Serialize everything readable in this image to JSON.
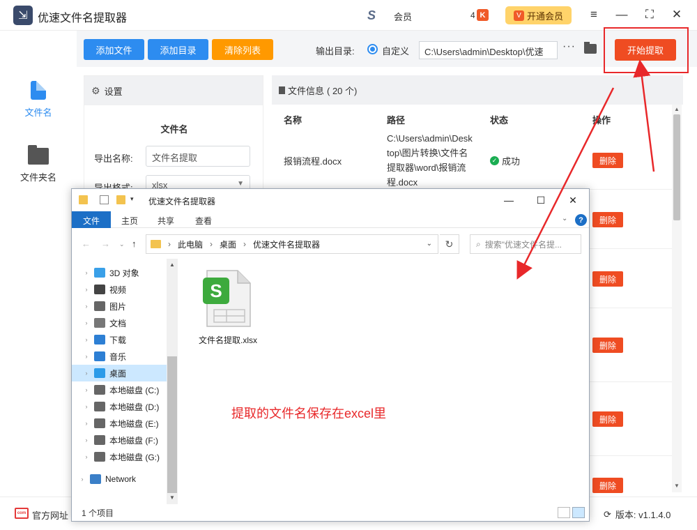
{
  "app": {
    "title": "优速文件名提取器",
    "vip_label": "会员",
    "coupon_count": "4",
    "open_vip_label": "开通会员"
  },
  "sidebar": {
    "items": [
      {
        "label": "文件名"
      },
      {
        "label": "文件夹名"
      }
    ]
  },
  "toolbar": {
    "add_file": "添加文件",
    "add_dir": "添加目录",
    "clear_list": "清除列表",
    "output_label": "输出目录:",
    "custom_label": "自定义",
    "output_path": "C:\\Users\\admin\\Desktop\\优速",
    "more": "···",
    "start": "开始提取"
  },
  "settings": {
    "header": "设置",
    "section": "文件名",
    "export_name_label": "导出名称:",
    "export_name_value": "文件名提取",
    "export_format_label": "导出格式:",
    "export_format_value": "xlsx"
  },
  "file_info": {
    "header": "文件信息",
    "count": "( 20 个)",
    "columns": [
      "名称",
      "路径",
      "状态",
      "操作"
    ],
    "rows": [
      {
        "name": "报销流程.docx",
        "path": "C:\\Users\\admin\\Desktop\\图片转换\\文件名提取器\\word\\报销流程.docx",
        "status": "成功",
        "action": "删除"
      },
      {
        "action": "删除"
      },
      {
        "action": "删除"
      },
      {
        "action": "删除"
      },
      {
        "action": "删除"
      },
      {
        "action": "删除"
      }
    ]
  },
  "statusbar": {
    "site_icon_text": "com",
    "site_link": "官方网址",
    "version": "版本: v1.1.4.0"
  },
  "explorer": {
    "title": "优速文件名提取器",
    "ribbon_tabs": [
      "文件",
      "主页",
      "共享",
      "查看"
    ],
    "breadcrumb": [
      "此电脑",
      "桌面",
      "优速文件名提取器"
    ],
    "search_placeholder": "搜索\"优速文件名提...",
    "tree": [
      {
        "label": "3D 对象",
        "icon": "cube-icon",
        "color": "#3aa0e8"
      },
      {
        "label": "视频",
        "icon": "video-icon",
        "color": "#444444"
      },
      {
        "label": "图片",
        "icon": "picture-icon",
        "color": "#666666"
      },
      {
        "label": "文档",
        "icon": "document-icon",
        "color": "#777777"
      },
      {
        "label": "下载",
        "icon": "download-icon",
        "color": "#2d7fd4"
      },
      {
        "label": "音乐",
        "icon": "music-icon",
        "color": "#2d7fd4"
      },
      {
        "label": "桌面",
        "icon": "desktop-icon",
        "color": "#2d9be8",
        "selected": true
      },
      {
        "label": "本地磁盘 (C:)",
        "icon": "drive-icon",
        "color": "#666666"
      },
      {
        "label": "本地磁盘 (D:)",
        "icon": "drive-icon",
        "color": "#666666"
      },
      {
        "label": "本地磁盘 (E:)",
        "icon": "drive-icon",
        "color": "#666666"
      },
      {
        "label": "本地磁盘 (F:)",
        "icon": "drive-icon",
        "color": "#666666"
      },
      {
        "label": "本地磁盘 (G:)",
        "icon": "drive-icon",
        "color": "#666666"
      },
      {
        "label": "Network",
        "icon": "network-icon",
        "color": "#3a7fc8"
      }
    ],
    "file_name": "文件名提取.xlsx",
    "file_badge": "S",
    "annotation": "提取的文件名保存在excel里",
    "item_count": "1 个项目"
  },
  "colors": {
    "primary_blue": "#2d8cf0",
    "orange": "#ff9900",
    "danger": "#ef4c22",
    "highlight": "#e8282a",
    "success": "#1aad52"
  }
}
